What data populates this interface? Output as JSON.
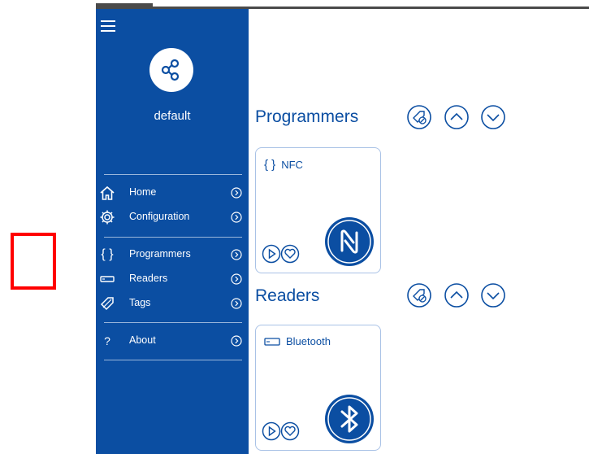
{
  "profile": {
    "name": "default"
  },
  "nav": {
    "home": "Home",
    "configuration": "Configuration",
    "programmers": "Programmers",
    "readers": "Readers",
    "tags": "Tags",
    "about": "About",
    "about_glyph": "?",
    "programmers_glyph": "{ }"
  },
  "sections": {
    "programmers": {
      "title": "Programmers",
      "card": {
        "glyph": "{ }",
        "label": "NFC",
        "logo": "nfc-logo-icon"
      }
    },
    "readers": {
      "title": "Readers",
      "card": {
        "glyph": "reader-icon",
        "label": "Bluetooth",
        "logo": "bluetooth-logo-icon"
      }
    }
  },
  "colors": {
    "sidebar": "#0b4ea2",
    "accent": "#0b4ea2",
    "card_border": "#a9c2e6",
    "highlight_box": "#ff0000"
  }
}
